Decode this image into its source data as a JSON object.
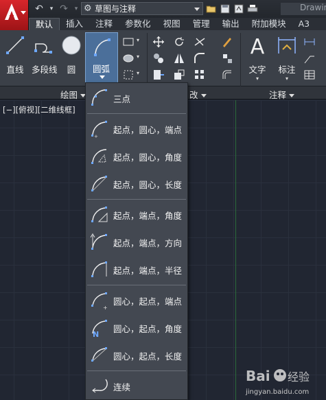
{
  "titlebar": {
    "workspace": "草图与注释",
    "doc_title": "Drawin"
  },
  "tabs": [
    "默认",
    "插入",
    "注释",
    "参数化",
    "视图",
    "管理",
    "输出",
    "附加模块",
    "A3"
  ],
  "ribbon": {
    "draw_tools": {
      "line": "直线",
      "polyline": "多段线",
      "circle": "圆",
      "arc": "圆弧"
    },
    "annotation_tools": {
      "text": "文字",
      "dimension": "标注"
    },
    "panels": {
      "draw": "绘图",
      "modify": "改",
      "annotation": "注释"
    }
  },
  "viewport": {
    "label": "[−][俯视][二维线框]"
  },
  "arc_menu": {
    "items": [
      {
        "label": "三点",
        "icon": "arc-3point-icon"
      },
      {
        "label": "起点，圆心，端点",
        "icon": "arc-start-center-end-icon"
      },
      {
        "label": "起点，圆心，角度",
        "icon": "arc-start-center-angle-icon"
      },
      {
        "label": "起点，圆心，长度",
        "icon": "arc-start-center-length-icon"
      },
      {
        "label": "起点，端点，角度",
        "icon": "arc-start-end-angle-icon"
      },
      {
        "label": "起点，端点，方向",
        "icon": "arc-start-end-direction-icon"
      },
      {
        "label": "起点，端点，半径",
        "icon": "arc-start-end-radius-icon"
      },
      {
        "label": "圆心，起点，端点",
        "icon": "arc-center-start-end-icon"
      },
      {
        "label": "圆心，起点，角度",
        "icon": "arc-center-start-angle-icon"
      },
      {
        "label": "圆心，起点，长度",
        "icon": "arc-center-start-length-icon"
      },
      {
        "label": "连续",
        "icon": "arc-continue-icon"
      }
    ]
  },
  "watermark": {
    "text": "jingyan.baidu.com"
  }
}
